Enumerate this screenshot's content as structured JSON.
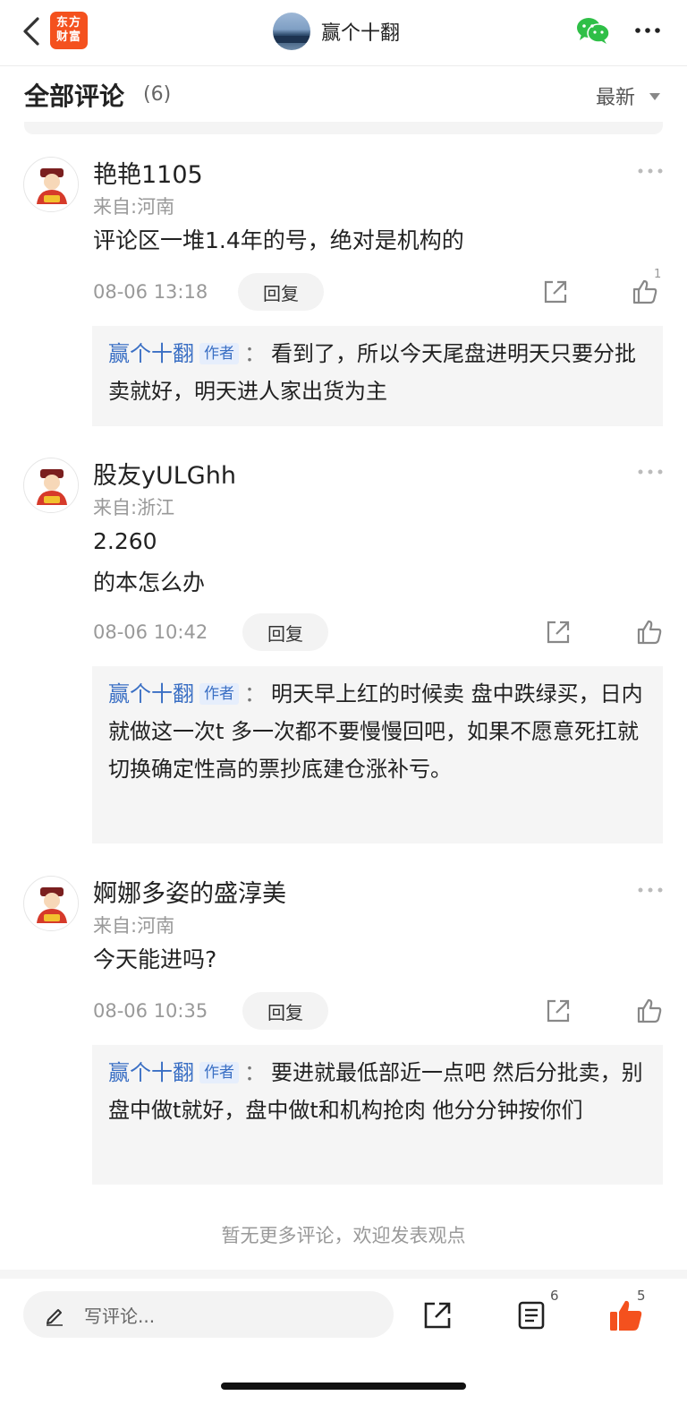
{
  "header": {
    "logo_line1": "东方",
    "logo_line2": "财富",
    "title": "赢个十翻"
  },
  "section": {
    "title": "全部评论",
    "count": "(6)",
    "sort_label": "最新"
  },
  "comments": [
    {
      "name": "艳艳1105",
      "location": "来自:河南",
      "text": "评论区一堆1.4年的号，绝对是机构的",
      "time": "08-06 13:18",
      "reply_label": "回复",
      "likes": "1",
      "author_reply": {
        "name": "赢个十翻",
        "tag": "作者",
        "colon": "：",
        "text": "看到了，所以今天尾盘进明天只要分批卖就好，明天进人家出货为主"
      }
    },
    {
      "name": "股友yULGhh",
      "location": "来自:浙江",
      "text": "2.260\n的本怎么办",
      "time": "08-06 10:42",
      "reply_label": "回复",
      "likes": "",
      "author_reply": {
        "name": "赢个十翻",
        "tag": "作者",
        "colon": "：",
        "text": "明天早上红的时候卖 盘中跌绿买，日内就做这一次t 多一次都不要慢慢回吧，如果不愿意死扛就切换确定性高的票抄底建仓涨补亏。"
      }
    },
    {
      "name": "婀娜多姿的盛淳美",
      "location": "来自:河南",
      "text": "今天能进吗?",
      "time": "08-06 10:35",
      "reply_label": "回复",
      "likes": "",
      "author_reply": {
        "name": "赢个十翻",
        "tag": "作者",
        "colon": "：",
        "text": "要进就最低部近一点吧 然后分批卖，别盘中做t就好，盘中做t和机构抢肉 他分分钟按你们"
      }
    }
  ],
  "footer_note": "暂无更多评论，欢迎发表观点",
  "bottom": {
    "write_placeholder": "写评论...",
    "list_count": "6",
    "like_count": "5"
  },
  "colors": {
    "accent_orange": "#f4511e",
    "author_blue": "#3a6fc4",
    "like_active": "#f4511e"
  }
}
